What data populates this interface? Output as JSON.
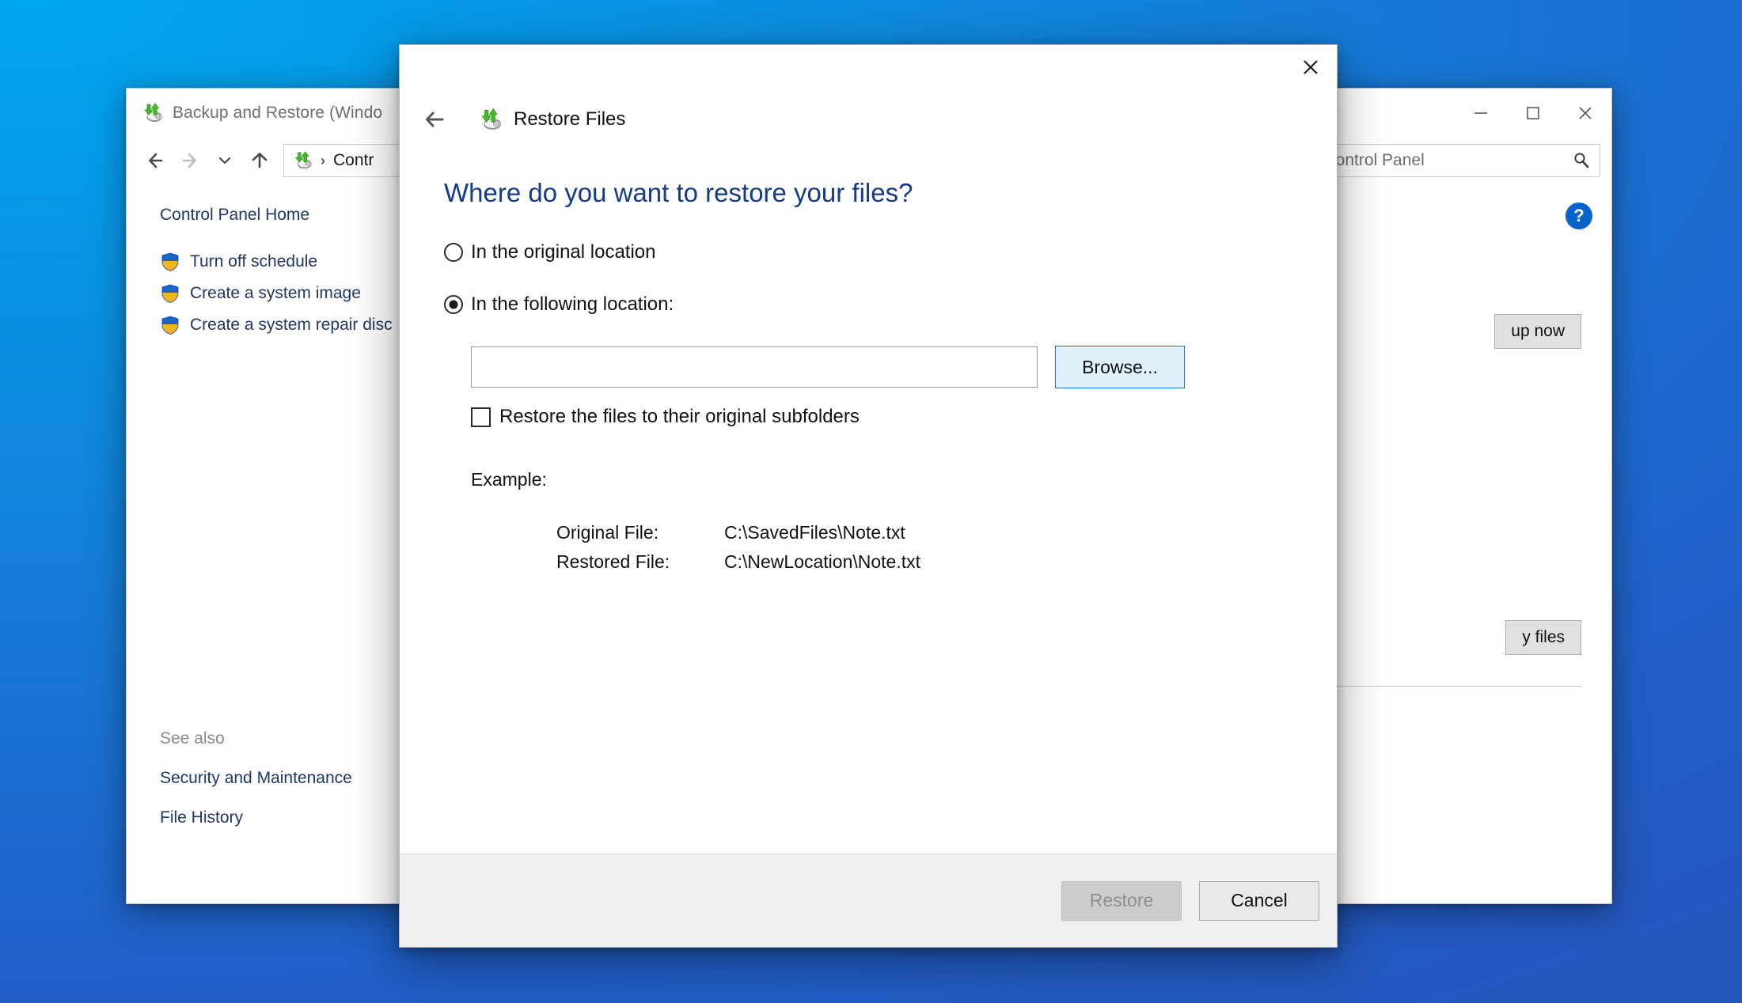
{
  "desktop": {
    "gradient_start": "#00a6f0",
    "gradient_end": "#2557bf"
  },
  "background_window": {
    "title": "Backup and Restore (Windo",
    "title_icon": "backup-restore-icon",
    "window_controls": {
      "minimize": "minimize-icon",
      "maximize": "maximize-icon",
      "close": "close-icon"
    },
    "nav": {
      "back": "back-arrow-icon",
      "forward": "forward-arrow-icon",
      "recent": "chevron-down-icon",
      "up": "up-arrow-icon"
    },
    "address": {
      "icon": "backup-restore-icon",
      "separator": "›",
      "text": "Contr"
    },
    "search": {
      "value": "h Control Panel",
      "icon": "search-icon"
    },
    "sidebar": {
      "home": "Control Panel Home",
      "links": [
        {
          "label": "Turn off schedule",
          "icon": "shield-icon"
        },
        {
          "label": "Create a system image",
          "icon": "shield-icon"
        },
        {
          "label": "Create a system repair disc",
          "icon": "shield-icon"
        }
      ],
      "see_also_title": "See also",
      "see_also": [
        "Security and Maintenance",
        "File History"
      ]
    },
    "content": {
      "help": "?",
      "backup_now_button": "up now",
      "restore_files_button": "y files"
    }
  },
  "dialog": {
    "close_icon": "close-icon",
    "back_icon": "back-arrow-icon",
    "header_icon": "backup-restore-icon",
    "header_title": "Restore Files",
    "question": "Where do you want to restore your files?",
    "options": [
      {
        "label": "In the original location",
        "checked": false
      },
      {
        "label": "In the following location:",
        "checked": true
      }
    ],
    "path_input": {
      "value": "",
      "placeholder": ""
    },
    "browse_button": "Browse...",
    "subfolders_checkbox": {
      "label": "Restore the files to their original subfolders",
      "checked": false
    },
    "example_title": "Example:",
    "example_rows": [
      {
        "label": "Original File:",
        "value": "C:\\SavedFiles\\Note.txt"
      },
      {
        "label": "Restored File:",
        "value": "C:\\NewLocation\\Note.txt"
      }
    ],
    "footer": {
      "restore_button": "Restore",
      "restore_enabled": false,
      "cancel_button": "Cancel"
    }
  }
}
